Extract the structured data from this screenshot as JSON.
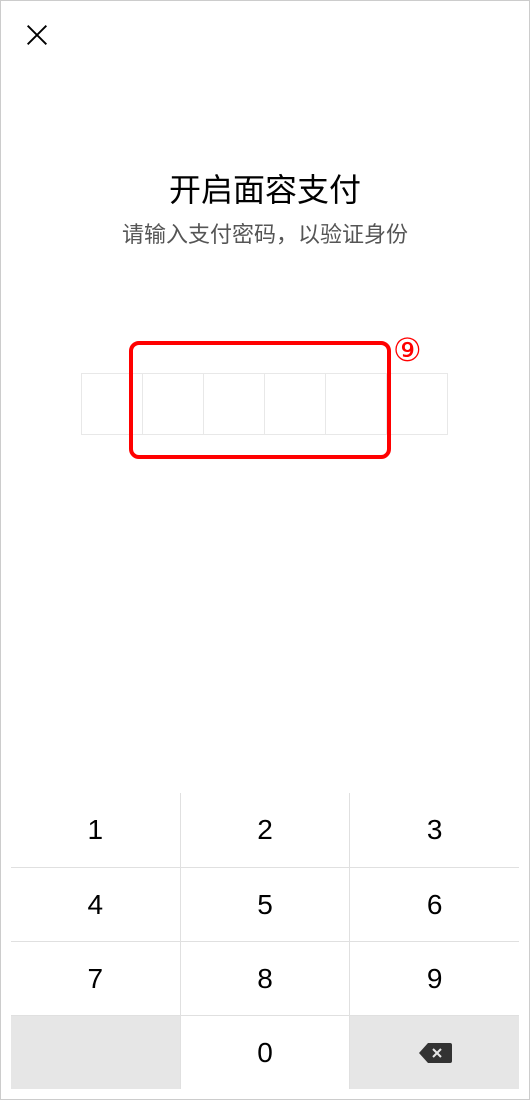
{
  "title": "开启面容支付",
  "subtitle": "请输入支付密码，以验证身份",
  "annotation": {
    "label": "⑨"
  },
  "keypad": {
    "k1": "1",
    "k2": "2",
    "k3": "3",
    "k4": "4",
    "k5": "5",
    "k6": "6",
    "k7": "7",
    "k8": "8",
    "k9": "9",
    "k0": "0"
  }
}
